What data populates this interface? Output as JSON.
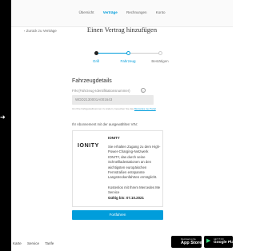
{
  "nav": {
    "items": [
      "Übersicht",
      "Verträge",
      "Rechnungen",
      "Konto"
    ],
    "active_index": 1
  },
  "header": {
    "back_label": "Zurück zu Verträge",
    "title": "Einen Vertrag hinzufügen"
  },
  "stepper": {
    "steps": [
      "Grill",
      "Fahrzeug",
      "Bestätigen"
    ],
    "current_step": 2,
    "colors": {
      "done": "#222222",
      "active": "#009ddb",
      "upcoming": "#cccccc"
    }
  },
  "vehicle": {
    "section_title": "Fahrzeugdetails",
    "fin_label": "FIN (Fahrzeug-Identifikationsnummer)",
    "fin_value": "WDD2130001A001643",
    "hint_prefix": "Um Ihre Fahrgestellnummer zu ändern, besuchen Sie das",
    "hint_link": "Mercedes me Portal"
  },
  "subscription": {
    "label": "Ihr Abonnement mit der ausgewählten VIN:",
    "logo_text": "IONITY",
    "title": "IONITY",
    "description": "Sie erhalten Zugang zu dem High-Power-Charging-Netzwerk IONITY, das durch seine Schnellladestationen an den wichtigsten europäischen Fernstraßen entspannte Langstreckenfahrten ermöglicht.",
    "cost_note": "Kostenlos mit Ihrem Mercedes Me Service",
    "valid_until": "Gültig bis: 07.10.2021"
  },
  "actions": {
    "continue_label": "Fortfahren"
  },
  "footer": {
    "links": [
      "Karte",
      "Service",
      "Tarife"
    ],
    "app_store": {
      "small": "Download on the",
      "big": "App Store"
    },
    "google_play": {
      "small": "GET IT ON",
      "big": "Google Play"
    }
  },
  "colors": {
    "accent": "#009ddb",
    "field_bg": "#e9e9e9"
  }
}
